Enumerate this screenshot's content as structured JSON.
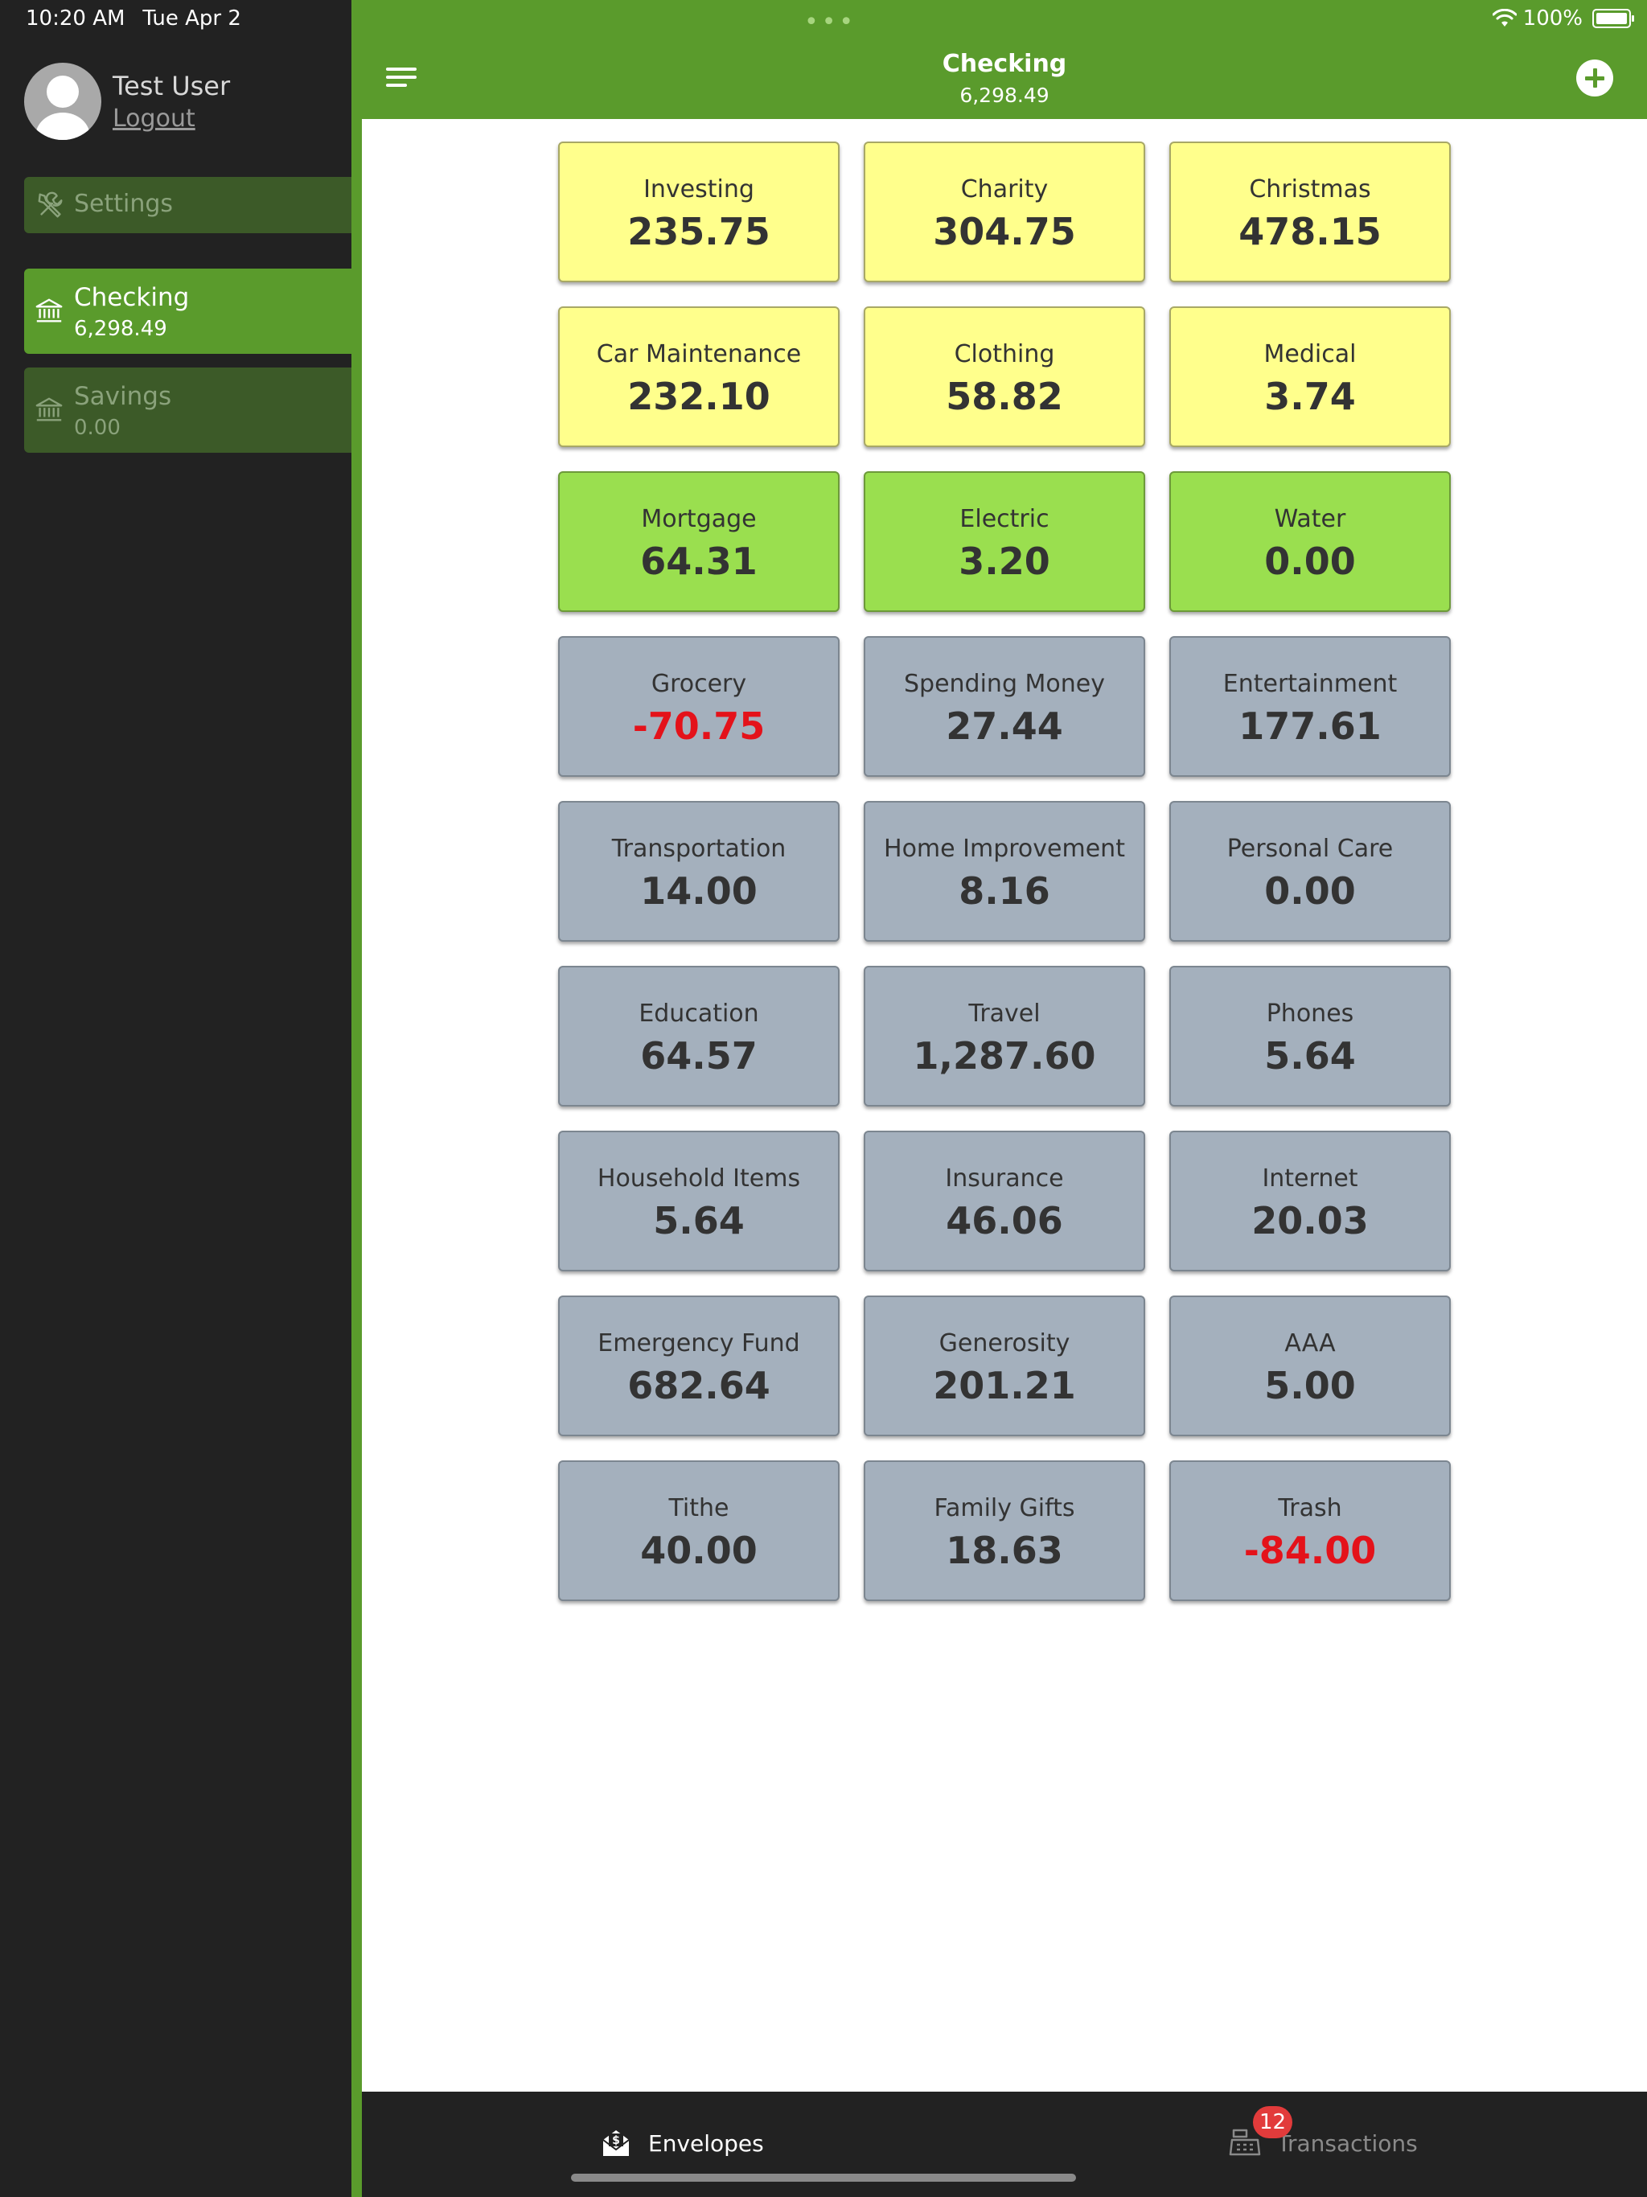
{
  "status_bar": {
    "time": "10:20 AM",
    "date": "Tue Apr 2",
    "battery": "100%"
  },
  "sidebar": {
    "user_name": "Test User",
    "logout_label": "Logout",
    "settings_label": "Settings",
    "accounts": [
      {
        "name": "Checking",
        "balance": "6,298.49",
        "active": true
      },
      {
        "name": "Savings",
        "balance": "0.00",
        "active": false
      }
    ]
  },
  "header": {
    "title": "Checking",
    "balance": "6,298.49"
  },
  "envelopes": [
    {
      "name": "Investing",
      "amount": "235.75",
      "color": "yellow"
    },
    {
      "name": "Charity",
      "amount": "304.75",
      "color": "yellow"
    },
    {
      "name": "Christmas",
      "amount": "478.15",
      "color": "yellow"
    },
    {
      "name": "Car Maintenance",
      "amount": "232.10",
      "color": "yellow"
    },
    {
      "name": "Clothing",
      "amount": "58.82",
      "color": "yellow"
    },
    {
      "name": "Medical",
      "amount": "3.74",
      "color": "yellow"
    },
    {
      "name": "Mortgage",
      "amount": "64.31",
      "color": "green"
    },
    {
      "name": "Electric",
      "amount": "3.20",
      "color": "green"
    },
    {
      "name": "Water",
      "amount": "0.00",
      "color": "green"
    },
    {
      "name": "Grocery",
      "amount": "-70.75",
      "color": "gray"
    },
    {
      "name": "Spending Money",
      "amount": "27.44",
      "color": "gray"
    },
    {
      "name": "Entertainment",
      "amount": "177.61",
      "color": "gray"
    },
    {
      "name": "Transportation",
      "amount": "14.00",
      "color": "gray"
    },
    {
      "name": "Home Improvement",
      "amount": "8.16",
      "color": "gray"
    },
    {
      "name": "Personal Care",
      "amount": "0.00",
      "color": "gray"
    },
    {
      "name": "Education",
      "amount": "64.57",
      "color": "gray"
    },
    {
      "name": "Travel",
      "amount": "1,287.60",
      "color": "gray"
    },
    {
      "name": "Phones",
      "amount": "5.64",
      "color": "gray"
    },
    {
      "name": "Household Items",
      "amount": "5.64",
      "color": "gray"
    },
    {
      "name": "Insurance",
      "amount": "46.06",
      "color": "gray"
    },
    {
      "name": "Internet",
      "amount": "20.03",
      "color": "gray"
    },
    {
      "name": "Emergency Fund",
      "amount": "682.64",
      "color": "gray"
    },
    {
      "name": "Generosity",
      "amount": "201.21",
      "color": "gray"
    },
    {
      "name": "AAA",
      "amount": "5.00",
      "color": "gray"
    },
    {
      "name": "Tithe",
      "amount": "40.00",
      "color": "gray"
    },
    {
      "name": "Family Gifts",
      "amount": "18.63",
      "color": "gray"
    },
    {
      "name": "Trash",
      "amount": "-84.00",
      "color": "gray"
    }
  ],
  "tabbar": {
    "envelopes_label": "Envelopes",
    "transactions_label": "Transactions",
    "transactions_badge": "12"
  },
  "colors": {
    "brand_green": "#5a9b2c",
    "negative": "#e4121a"
  }
}
